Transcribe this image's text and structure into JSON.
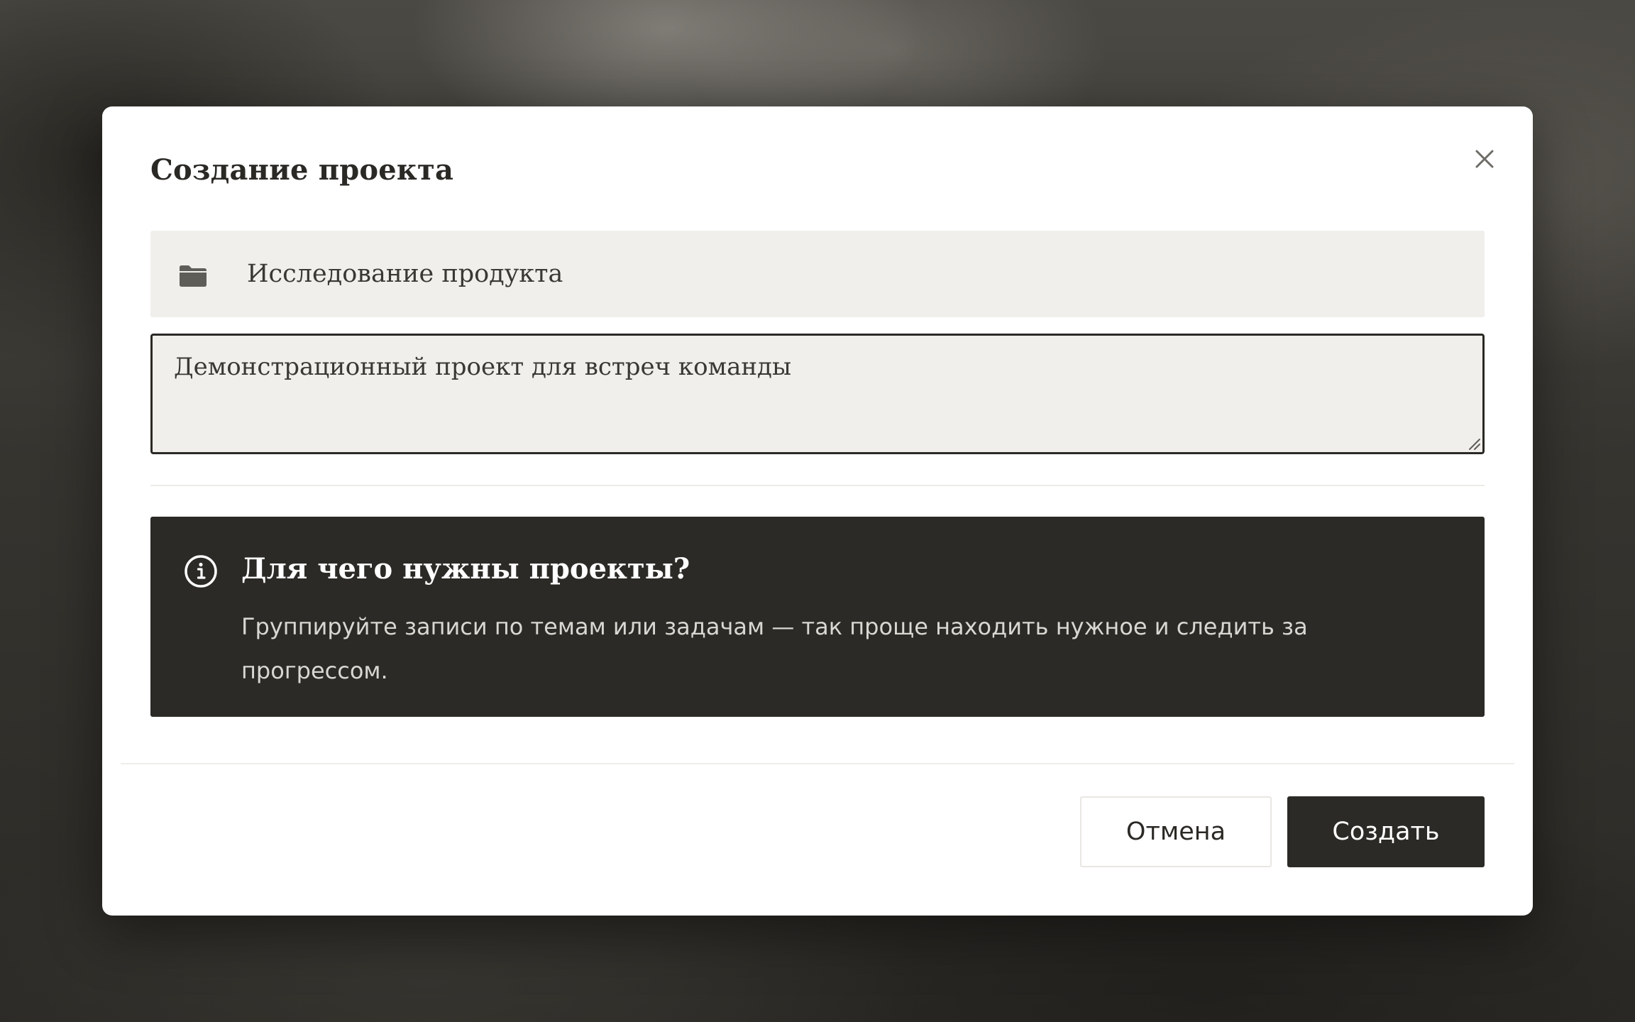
{
  "modal": {
    "title": "Создание проекта",
    "close_icon": "close-icon"
  },
  "form": {
    "name_icon": "folder-icon",
    "name_value": "Исследование продукта",
    "description_value": "Демонстрационный проект для встреч команды"
  },
  "info": {
    "icon": "info-icon",
    "title": "Для чего нужны проекты?",
    "body": "Группируйте записи по темам или задачам — так проще находить нужное и следить за прогрессом."
  },
  "actions": {
    "cancel_label": "Отмена",
    "create_label": "Создать"
  },
  "colors": {
    "accent_dark": "#2b2a26",
    "field_background": "#f0efec",
    "modal_background": "#ffffff"
  }
}
